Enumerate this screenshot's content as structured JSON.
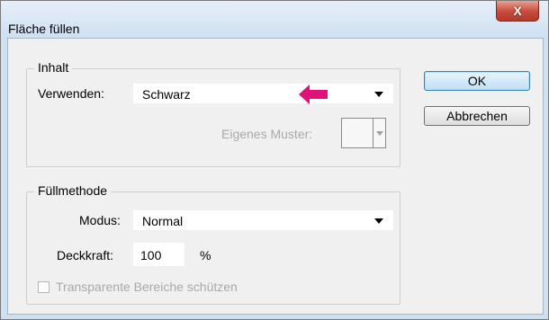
{
  "dialog": {
    "title": "Fläche füllen",
    "close_glyph": "X"
  },
  "content_group": {
    "legend": "Inhalt",
    "use_label": "Verwenden:",
    "use_value": "Schwarz",
    "custom_pattern_label": "Eigenes Muster:"
  },
  "blend_group": {
    "legend": "Füllmethode",
    "mode_label": "Modus:",
    "mode_value": "Normal",
    "opacity_label": "Deckkraft:",
    "opacity_value": "100",
    "opacity_unit": "%",
    "preserve_transparency_label": "Transparente Bereiche schützen",
    "preserve_transparency_checked": false
  },
  "buttons": {
    "ok_label": "OK",
    "cancel_label": "Abbrechen"
  },
  "annotation": {
    "arrow_color": "#e0127a"
  },
  "colors": {
    "title_bar": "#cfe0f1",
    "dialog_bg": "#f0f0f0",
    "close_button": "#c74a3a"
  }
}
